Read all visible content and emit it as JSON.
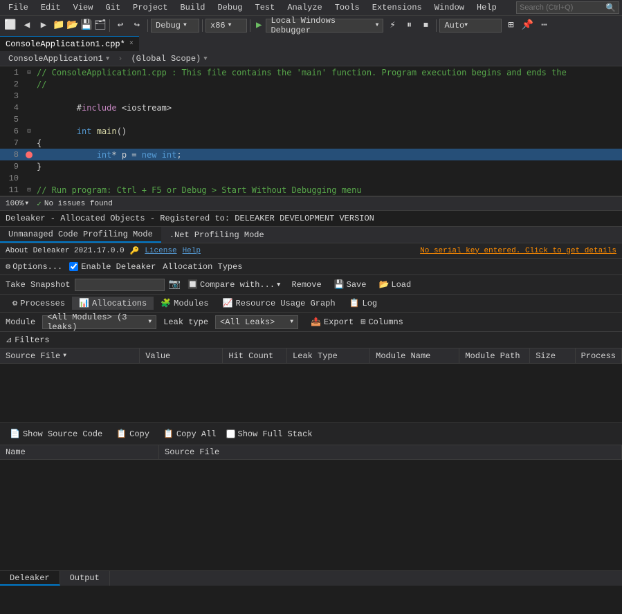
{
  "menuBar": {
    "items": [
      "File",
      "Edit",
      "View",
      "Git",
      "Project",
      "Build",
      "Debug",
      "Test",
      "Analyze",
      "Tools",
      "Extensions",
      "Window",
      "Help"
    ],
    "search": {
      "placeholder": "Search (Ctrl+Q)"
    }
  },
  "toolbar1": {
    "config": "Debug",
    "platform": "x86",
    "debugger": "Local Windows Debugger",
    "auto": "Auto"
  },
  "tab": {
    "filename": "ConsoleApplication1.cpp*",
    "close": "×"
  },
  "breadcrumb": {
    "left": "ConsoleApplication1",
    "right": "(Global Scope)"
  },
  "editor": {
    "lines": [
      {
        "num": 1,
        "collapse": true,
        "content": "// ConsoleApplication1.cpp : This file contains the 'main' function. Program execution begins and ends the",
        "class": "code-comment"
      },
      {
        "num": 2,
        "content": "//",
        "class": "code-comment"
      },
      {
        "num": 3,
        "content": ""
      },
      {
        "num": 4,
        "content": "#include <iostream>",
        "class": "code-include"
      },
      {
        "num": 5,
        "content": ""
      },
      {
        "num": 6,
        "collapse": true,
        "content": "int main()",
        "class": "code-keyword"
      },
      {
        "num": 7,
        "content": "{"
      },
      {
        "num": 8,
        "content": "    int* p = new int;",
        "breakpoint": true,
        "current": true
      },
      {
        "num": 9,
        "content": "}"
      },
      {
        "num": 10,
        "content": ""
      },
      {
        "num": 11,
        "collapse": true,
        "content": "// Run program: Ctrl + F5 or Debug > Start Without Debugging menu",
        "class": "code-comment"
      }
    ]
  },
  "statusBar": {
    "zoom": "100%",
    "issues": "No issues found"
  },
  "deleaker": {
    "titleBar": "Deleaker - Allocated Objects - Registered to: DELEAKER DEVELOPMENT VERSION",
    "tabs": [
      "Unmanaged Code Profiling Mode",
      ".Net Profiling Mode"
    ],
    "activeTab": 0,
    "infoBar": {
      "about": "About Deleaker 2021.17.0.0",
      "licenseIcon": "🔑",
      "license": "License",
      "help": "Help",
      "serialKey": "No serial key entered. Click to get details"
    },
    "optionsBar": {
      "options": "Options...",
      "enableLabel": "Enable Deleaker",
      "allocTypes": "Allocation Types"
    },
    "toolbar": {
      "snapshotLabel": "Take Snapshot",
      "snapshotValue": "",
      "compareLabel": "Compare with...",
      "removeLabel": "Remove",
      "saveLabel": "Save",
      "loadLabel": "Load"
    },
    "nav": {
      "items": [
        "Processes",
        "Allocations",
        "Modules",
        "Resource Usage Graph",
        "Log"
      ]
    },
    "filterRow": {
      "moduleLabel": "Module",
      "moduleValue": "<All Modules> (3 leaks)",
      "leakTypeLabel": "Leak type",
      "leakTypeValue": "<All Leaks>",
      "exportLabel": "Export",
      "columnsLabel": "Columns"
    },
    "filtersLabel": "Filters",
    "tableHeaders": [
      "Source File",
      "Value",
      "Hit Count",
      "Leak Type",
      "Module Name",
      "Module Path",
      "Size",
      "Process"
    ],
    "bottomToolbar": {
      "showSourceCode": "Show Source Code",
      "copy1": "Copy",
      "copy2": "Copy All",
      "showFullStack": "Show Full Stack"
    },
    "callstackHeaders": [
      "Name",
      "Source File"
    ],
    "bottomTabs": [
      "Deleaker",
      "Output"
    ]
  }
}
